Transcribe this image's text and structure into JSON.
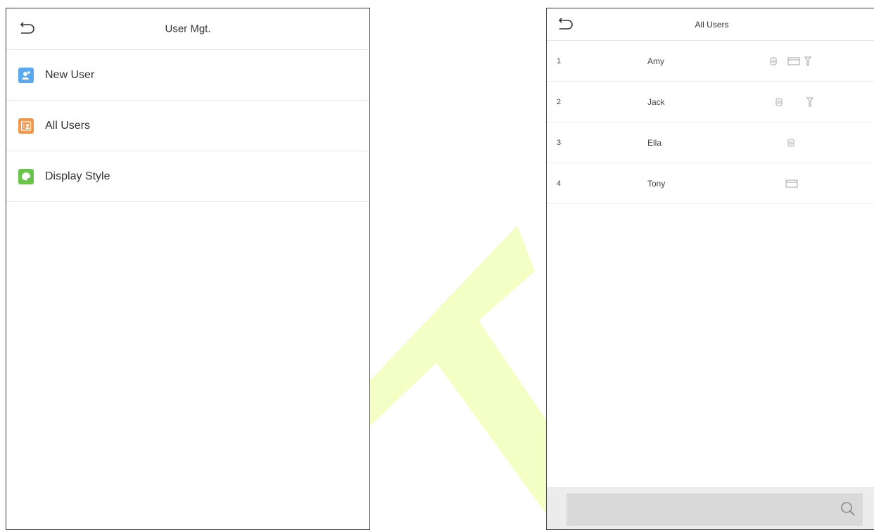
{
  "left_screen": {
    "title": "User Mgt.",
    "menu": [
      {
        "label": "New User",
        "icon": "new-user-icon",
        "color": "#5aa9f0"
      },
      {
        "label": "All Users",
        "icon": "all-users-icon",
        "color": "#f1964a"
      },
      {
        "label": "Display Style",
        "icon": "display-style-icon",
        "color": "#69c44a"
      }
    ]
  },
  "right_screen": {
    "title": "All Users",
    "users": [
      {
        "no": "1",
        "name": "Amy",
        "credentials": [
          "fingerprint",
          "card",
          "password"
        ]
      },
      {
        "no": "2",
        "name": "Jack",
        "credentials": [
          "fingerprint",
          "password"
        ]
      },
      {
        "no": "3",
        "name": "Ella",
        "credentials": [
          "fingerprint"
        ]
      },
      {
        "no": "4",
        "name": "Tony",
        "credentials": [
          "card"
        ]
      }
    ],
    "search": {
      "placeholder": ""
    }
  },
  "colors": {
    "watermark": "#f4ffc6",
    "border": "#3a3a3a",
    "search_bg": "#ececec"
  }
}
